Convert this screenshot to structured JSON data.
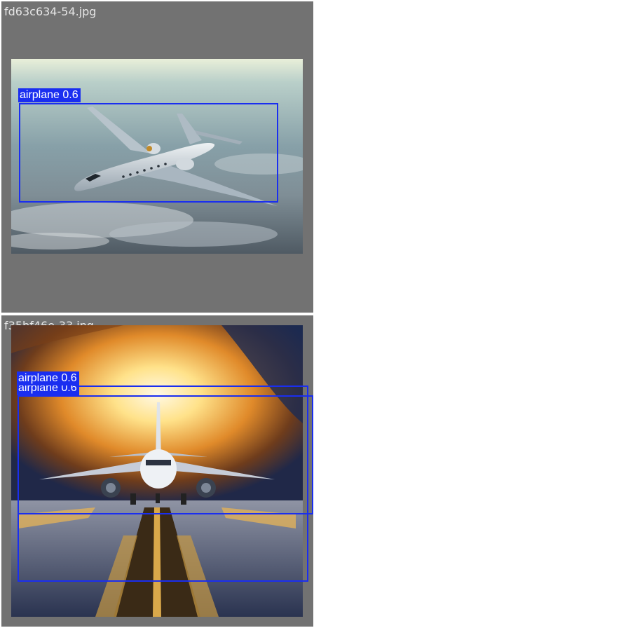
{
  "tiles": [
    {
      "filename": "fd63c634-54.jpg",
      "detections": [
        {
          "class": "airplane",
          "label": "airplane 0.6",
          "confidence": 0.6
        }
      ]
    },
    {
      "filename": "f35bf46e-33.jpg",
      "detections": [
        {
          "class": "airplane",
          "label": "airplane 0.6",
          "confidence": 0.6
        },
        {
          "class": "airplane",
          "label": "airplane 0.6",
          "confidence": 0.6
        }
      ]
    }
  ],
  "colors": {
    "tile_background": "#727272",
    "box_color": "#1a2ef0",
    "label_text": "#ffffff",
    "page_background": "#ffffff"
  }
}
